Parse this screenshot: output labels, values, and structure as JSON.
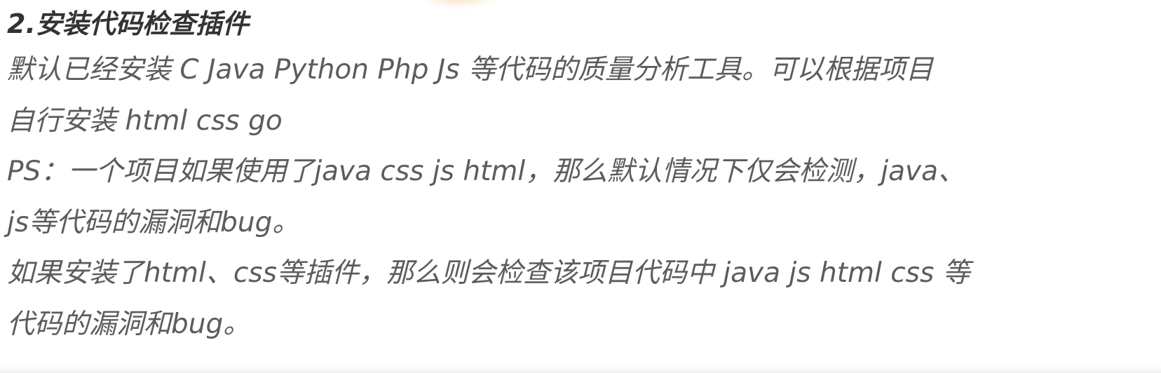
{
  "section": {
    "heading": "2.安装代码检查插件",
    "lines": [
      "默认已经安装 C Java Python Php Js 等代码的质量分析工具。可以根据项目",
      "自行安装 html css go",
      "PS：一个项目如果使用了java css js html，那么默认情况下仅会检测，java、",
      "js等代码的漏洞和bug。",
      "如果安装了html、css等插件，那么则会检查该项目代码中 java js html css 等",
      "代码的漏洞和bug。"
    ]
  },
  "colors": {
    "heading": "#333333",
    "body_text": "#5c5c5c",
    "background": "#ffffff"
  }
}
